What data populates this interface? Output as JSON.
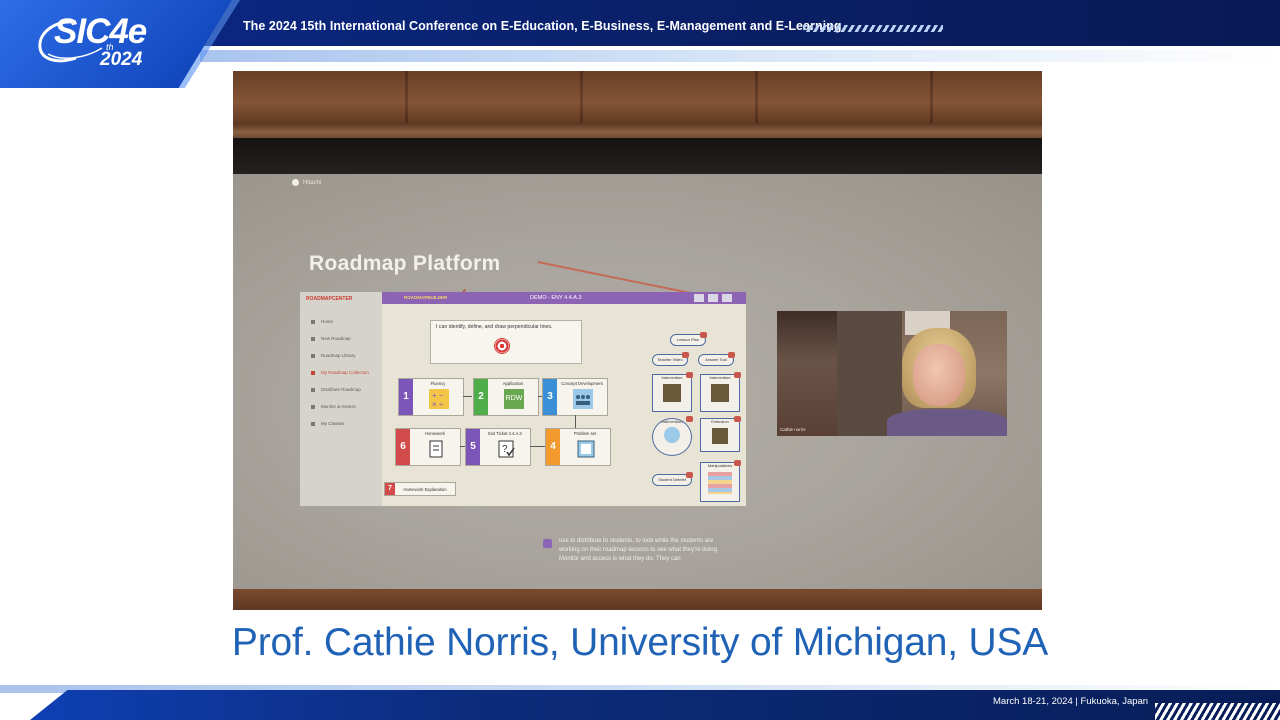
{
  "header": {
    "title": "The 2024 15th International Conference on E-Education, E-Business, E-Management and E-Learning",
    "logo": {
      "main": "SIC4e",
      "superscript": "th",
      "year": "2024"
    },
    "colors": {
      "bar": "#0a1f66",
      "accent": "#2d6ee8"
    }
  },
  "photo": {
    "screen": {
      "caption": "Hitachi",
      "slide_title": "Roadmap Platform",
      "app": {
        "sidebar_logo": "ROADMAPCENTER",
        "sidebar_items": [
          {
            "label": "Home"
          },
          {
            "label": "New Roadmap"
          },
          {
            "label": "Roadmap Library"
          },
          {
            "label": "My Roadmap Collection"
          },
          {
            "label": "Distribute Roadmap"
          },
          {
            "label": "Monitor & Assess"
          },
          {
            "label": "My Classes"
          }
        ],
        "top_logo": "ROADMAPBUILDER",
        "top_title": "DEMO - ENY 4.4.A.3",
        "objective": "I can identify, define, and draw perpendicular lines.",
        "steps": [
          {
            "num": "1",
            "label": "Fluency",
            "color": "#7b55b8"
          },
          {
            "num": "2",
            "label": "Application",
            "color": "#4fae4a"
          },
          {
            "num": "3",
            "label": "Concept Development",
            "color": "#3b8fd6"
          },
          {
            "num": "4",
            "label": "Problem set",
            "color": "#f29a2e"
          },
          {
            "num": "5",
            "label": "Exit Ticket 4.4.A.3",
            "color": "#7b55b8"
          },
          {
            "num": "6",
            "label": "Homework",
            "color": "#d14b4b"
          },
          {
            "num": "7",
            "label": "Homework Explanation",
            "color": "#d14b4b"
          }
        ],
        "app_text": "RDW",
        "resources": [
          {
            "label": "Lesson Plan"
          },
          {
            "label": "Teacher Video"
          },
          {
            "label": "Answer Tool"
          },
          {
            "label": "Intervention"
          },
          {
            "label": "Intervention"
          },
          {
            "label": "Intervention"
          },
          {
            "label": "Extension"
          },
          {
            "label": "Manipulatives"
          },
          {
            "label": "Student Debrief"
          }
        ]
      },
      "video_name": "Cathie norris",
      "transcript": "use to distribute to students, to look while the students are working on their roadmap lessons to see what they're doing. Monitor and access is what they do. They can"
    }
  },
  "speaker": "Prof. Cathie Norris, University of Michigan, USA",
  "footer": {
    "text": "March 18-21, 2024  |  Fukuoka, Japan"
  }
}
